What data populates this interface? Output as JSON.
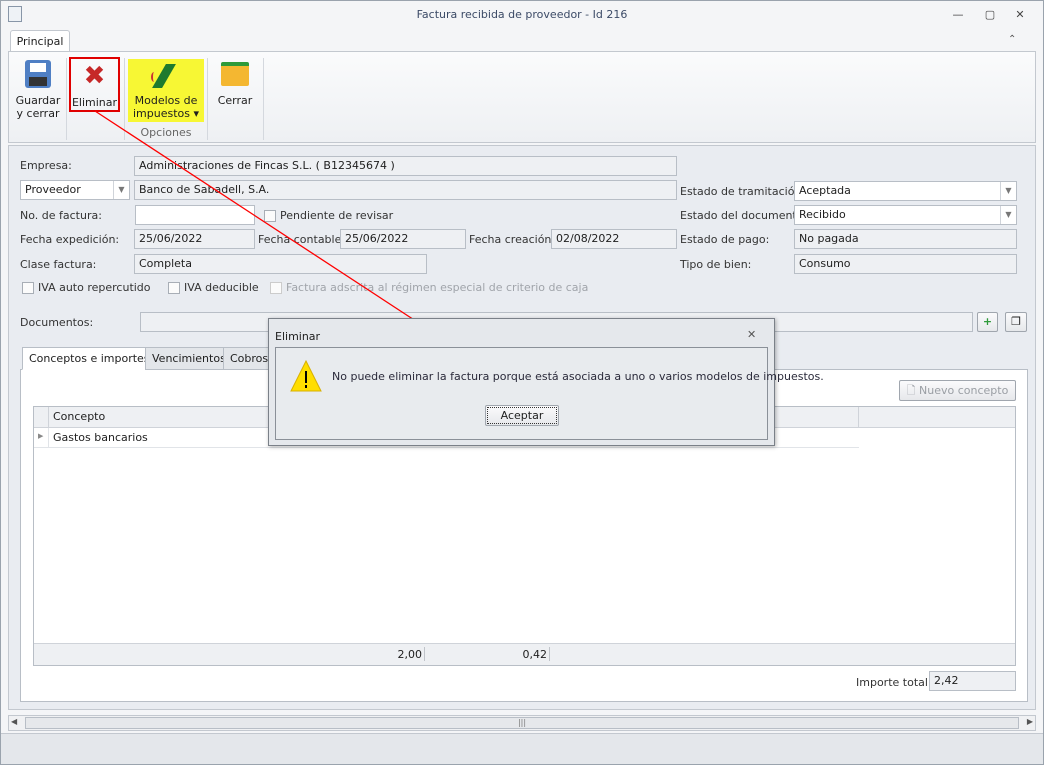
{
  "window": {
    "title": "Factura recibida de proveedor - Id 216",
    "minimize": "—",
    "maximize": "▢",
    "close": "✕"
  },
  "ribbon": {
    "tab": "Principal",
    "collapse": "⌃",
    "save": [
      "Guardar",
      "y cerrar"
    ],
    "delete": "Eliminar",
    "models": [
      "Modelos de",
      "impuestos ▾"
    ],
    "group": "Opciones",
    "close": "Cerrar"
  },
  "form": {
    "empresa_label": "Empresa:",
    "empresa": "Administraciones de Fincas S.L. ( B12345674 )",
    "tipo_tercero": "Proveedor",
    "proveedor": "Banco de Sabadell, S.A.",
    "nofactura_label": "No. de factura:",
    "nofactura": "",
    "pendiente": "Pendiente de revisar",
    "fexp_label": "Fecha expedición:",
    "fexp": "25/06/2022",
    "fcont_label": "Fecha contable:",
    "fcont": "25/06/2022",
    "fcrea_label": "Fecha creación:",
    "fcrea": "02/08/2022",
    "clase_label": "Clase factura:",
    "clase": "Completa",
    "estado_tram_label": "Estado de tramitación:",
    "estado_tram": "Aceptada",
    "estado_doc_label": "Estado del documento:",
    "estado_doc": "Recibido",
    "estado_pago_label": "Estado de pago:",
    "estado_pago": "No pagada",
    "tipo_bien_label": "Tipo de bien:",
    "tipo_bien": "Consumo",
    "iva_auto": "IVA auto repercutido",
    "iva_ded": "IVA deducible",
    "criterio_caja": "Factura adscrita al régimen especial de criterio de caja",
    "documentos_label": "Documentos:",
    "documentos": ""
  },
  "tabs": [
    "Conceptos e importes",
    "Vencimientos",
    "Cobros"
  ],
  "grid": {
    "new_concept": "Nuevo concepto",
    "header": "Concepto",
    "rows": [
      "Gastos bancarios"
    ],
    "totals": [
      "2,00",
      "0,42"
    ]
  },
  "importe_total_label": "Importe total:",
  "importe_total": "2,42",
  "dialog": {
    "title": "Eliminar",
    "message": "No puede eliminar la factura porque está asociada a uno o varios modelos de impuestos.",
    "ok": "Aceptar",
    "close": "✕"
  },
  "colors": {
    "highlight": "#f7f734",
    "red_box": "#e00000",
    "arrow": "#ff0000"
  }
}
